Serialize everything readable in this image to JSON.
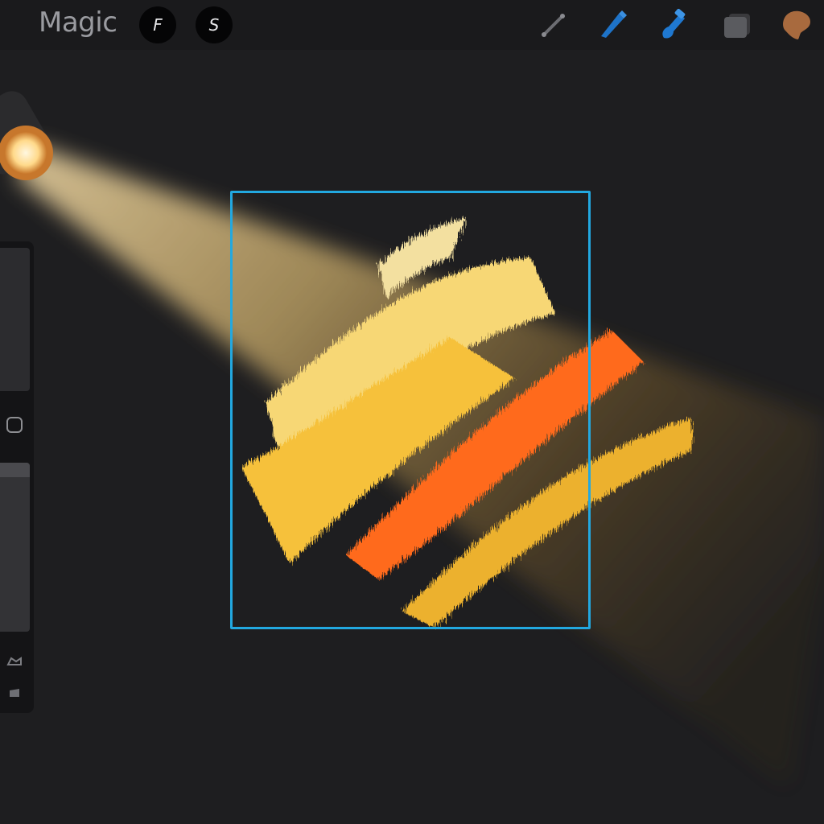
{
  "app": {
    "title": "Magic"
  },
  "toolbar": {
    "buttons": [
      {
        "label": "F",
        "icon": "f-button"
      },
      {
        "label": "S",
        "icon": "s-button"
      }
    ],
    "tools": [
      {
        "name": "wrench",
        "icon": "wrench-icon"
      },
      {
        "name": "brush",
        "icon": "brush-icon"
      },
      {
        "name": "smudge",
        "icon": "smudge-icon"
      },
      {
        "name": "layers",
        "icon": "layers-icon"
      },
      {
        "name": "color",
        "icon": "color-swatch-icon",
        "color": "#a86a3e"
      }
    ]
  },
  "canvas": {
    "selection_color": "#22a8e0",
    "stroke_colors": [
      "#f7d774",
      "#f6c13a",
      "#ff6a1a",
      "#ecb12e"
    ],
    "spotlight_color": "#ffe3a6"
  },
  "sidebar": {
    "sliders": [
      {
        "name": "brush-size",
        "icon": "brush-size-slider"
      },
      {
        "name": "opacity",
        "icon": "opacity-slider"
      }
    ],
    "actions": [
      {
        "name": "modify",
        "icon": "square-button"
      },
      {
        "name": "undo",
        "icon": "undo-icon"
      },
      {
        "name": "redo",
        "icon": "redo-icon"
      }
    ]
  }
}
